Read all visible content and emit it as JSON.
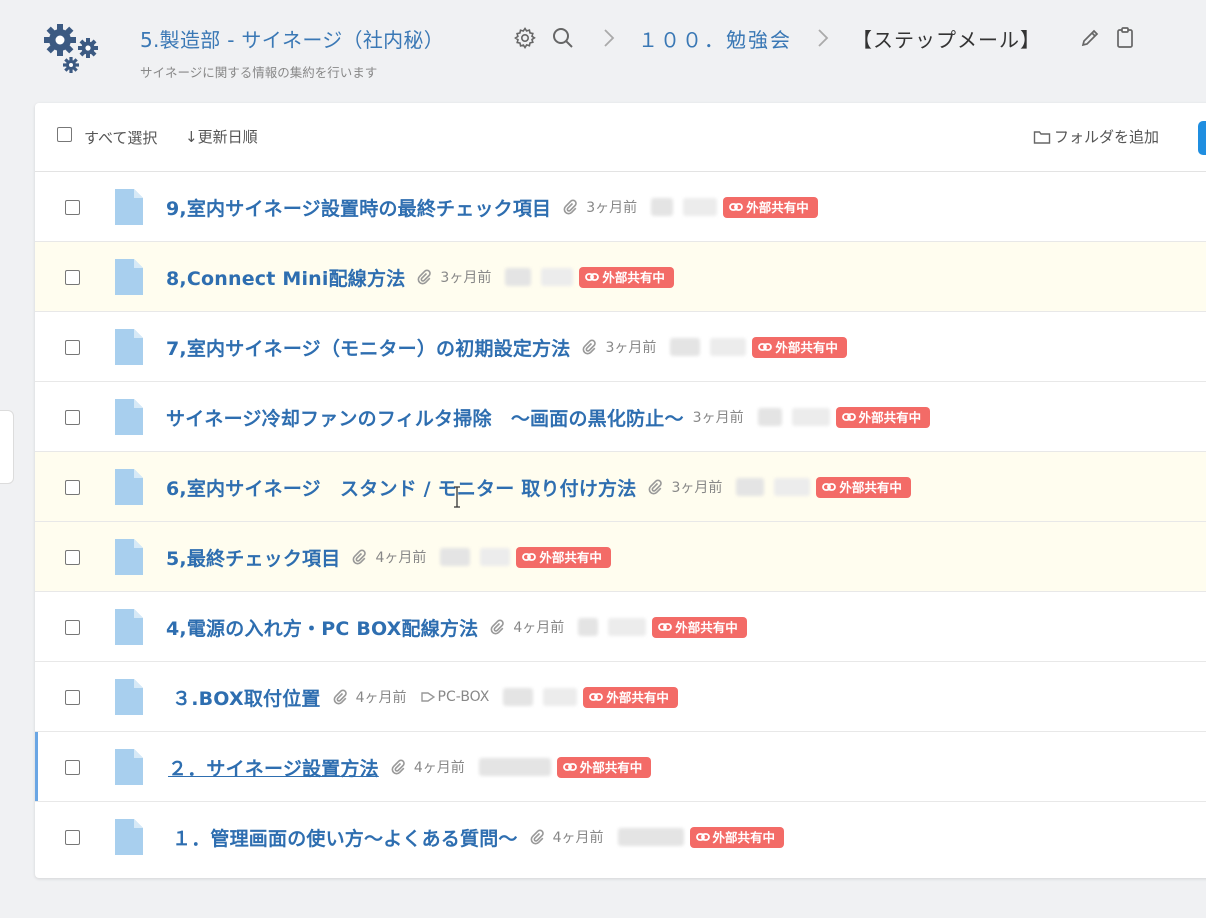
{
  "header": {
    "space_title": "5.製造部 - サイネージ（社内秘）",
    "space_subtitle": "サイネージに関する情報の集約を行います",
    "breadcrumb": {
      "folder": "１００．勉強会",
      "current": "【ステップメール】"
    }
  },
  "toolbar": {
    "select_all_label": "すべて選択",
    "sort_label": "↓更新日順",
    "add_folder_label": "フォルダを追加"
  },
  "share_badge_label": "外部共有中",
  "colors": {
    "accent": "#3a78b5",
    "share_badge": "#f36b67",
    "highlight_row": "#fffdef",
    "primary_button": "#1f8ee0"
  },
  "rows": [
    {
      "title": "9,室内サイネージ設置時の最終チェック項目",
      "time": "3ヶ月前",
      "tag": "",
      "highlighted": false,
      "active": false
    },
    {
      "title": "8,Connect Mini配線方法",
      "time": "3ヶ月前",
      "tag": "",
      "highlighted": true,
      "active": false
    },
    {
      "title": "7,室内サイネージ（モニター）の初期設定方法",
      "time": "3ヶ月前",
      "tag": "",
      "highlighted": false,
      "active": false
    },
    {
      "title": "サイネージ冷却ファンのフィルタ掃除　～画面の黒化防止～",
      "time": "3ヶ月前",
      "tag": "",
      "highlighted": false,
      "active": false
    },
    {
      "title": "6,室内サイネージ　スタンド / モニター 取り付け方法",
      "time": "3ヶ月前",
      "tag": "",
      "highlighted": true,
      "active": false
    },
    {
      "title": "5,最終チェック項目",
      "time": "4ヶ月前",
      "tag": "",
      "highlighted": true,
      "active": false
    },
    {
      "title": "4,電源の入れ方・PC BOX配線方法",
      "time": "4ヶ月前",
      "tag": "",
      "highlighted": false,
      "active": false
    },
    {
      "title": "３.BOX取付位置",
      "time": "4ヶ月前",
      "tag": "PC-BOX",
      "highlighted": false,
      "active": false
    },
    {
      "title": "２．サイネージ設置方法",
      "time": "4ヶ月前",
      "tag": "",
      "highlighted": false,
      "active": true
    },
    {
      "title": "１．管理画面の使い方～よくある質問～",
      "time": "4ヶ月前",
      "tag": "",
      "highlighted": false,
      "active": false
    }
  ]
}
